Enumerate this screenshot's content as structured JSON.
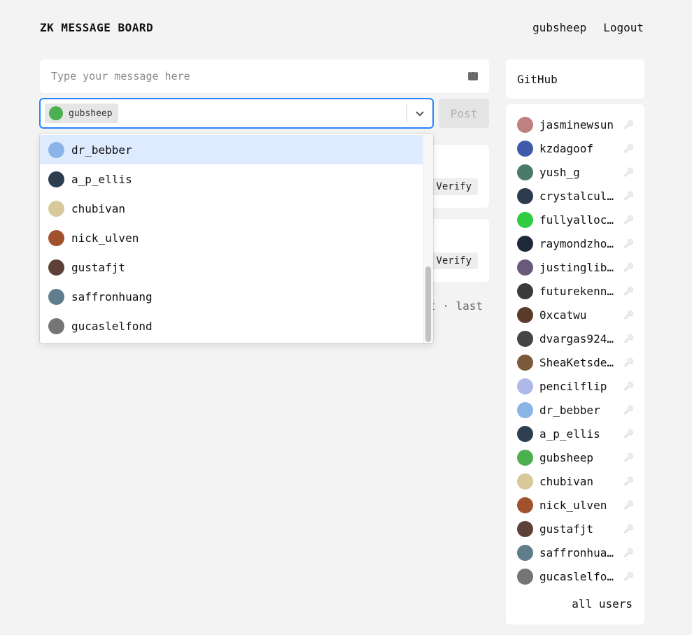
{
  "header": {
    "title": "ZK MESSAGE BOARD",
    "username": "gubsheep",
    "logout": "Logout"
  },
  "composer": {
    "placeholder": "Type your message here",
    "post_label": "Post"
  },
  "selector": {
    "selected": {
      "name": "gubsheep",
      "color": "#4caf50"
    }
  },
  "dropdown": {
    "options": [
      {
        "name": "dr_bebber",
        "color": "#8ab4e8"
      },
      {
        "name": "a_p_ellis",
        "color": "#2c3e50"
      },
      {
        "name": "chubivan",
        "color": "#d8c99b"
      },
      {
        "name": "nick_ulven",
        "color": "#a0522d"
      },
      {
        "name": "gustafjt",
        "color": "#5d4037"
      },
      {
        "name": "saffronhuang",
        "color": "#607d8b"
      },
      {
        "name": "gucaslelfond",
        "color": "#757575"
      }
    ]
  },
  "messages": [
    {
      "verify": "Verify"
    },
    {
      "verify": "Verify"
    }
  ],
  "pagination": {
    "text": "xt · last"
  },
  "sidebar": {
    "github": "GitHub",
    "all_users": "all users",
    "users": [
      {
        "name": "jasminewsun",
        "color": "#c08080"
      },
      {
        "name": "kzdagoof",
        "color": "#3f5aa8"
      },
      {
        "name": "yush_g",
        "color": "#4a7a6a"
      },
      {
        "name": "crystalcul…",
        "color": "#2e3b4e"
      },
      {
        "name": "fullyalloc…",
        "color": "#2ecc40"
      },
      {
        "name": "raymondzho…",
        "color": "#1e2a3a"
      },
      {
        "name": "justinglib…",
        "color": "#6a5a7a"
      },
      {
        "name": "futurekenn…",
        "color": "#3a3a3a"
      },
      {
        "name": "0xcatwu",
        "color": "#5a3a2a"
      },
      {
        "name": "dvargas924…",
        "color": "#444444"
      },
      {
        "name": "SheaKetsde…",
        "color": "#7a5a3a"
      },
      {
        "name": "pencilflip",
        "color": "#b0b8e8"
      },
      {
        "name": "dr_bebber",
        "color": "#8ab4e8"
      },
      {
        "name": "a_p_ellis",
        "color": "#2c3e50"
      },
      {
        "name": "gubsheep",
        "color": "#4caf50"
      },
      {
        "name": "chubivan",
        "color": "#d8c99b"
      },
      {
        "name": "nick_ulven",
        "color": "#a0522d"
      },
      {
        "name": "gustafjt",
        "color": "#5d4037"
      },
      {
        "name": "saffronhuang",
        "color": "#607d8b"
      },
      {
        "name": "gucaslelfo…",
        "color": "#757575"
      }
    ]
  },
  "icons": {
    "keyboard": "keyboard-icon",
    "chevron": "chevron-down-icon",
    "key": "key-icon"
  }
}
